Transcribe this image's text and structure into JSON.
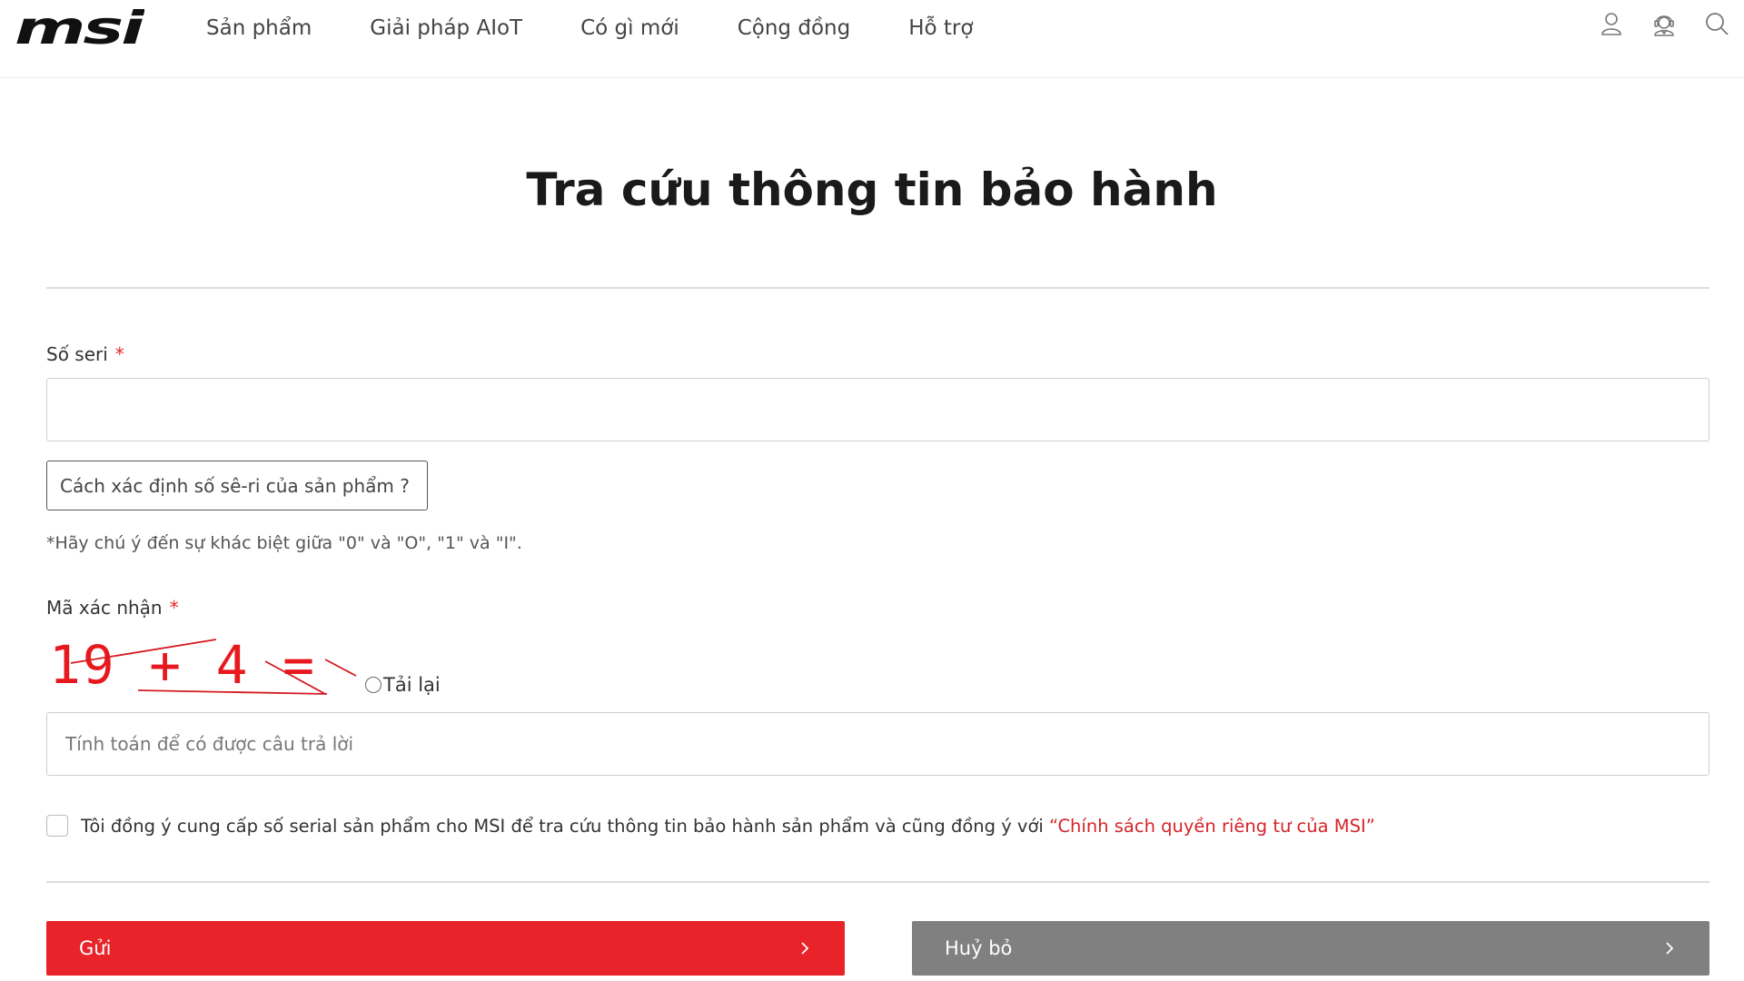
{
  "header": {
    "logo_text": "msi",
    "nav": [
      "Sản phẩm",
      "Giải pháp AIoT",
      "Có gì mới",
      "Cộng đồng",
      "Hỗ trợ"
    ],
    "icons": [
      "user-icon",
      "support-agent-icon",
      "search-icon"
    ]
  },
  "page": {
    "title": "Tra cứu thông tin bảo hành"
  },
  "form": {
    "serial": {
      "label": "Số seri",
      "required_mark": "*",
      "value": ""
    },
    "serial_help_button": "Cách xác định số sê-ri của sản phẩm ?",
    "note": "*Hãy chú ý đến sự khác biệt giữa \"0\" và \"O\", \"1\" và \"I\".",
    "captcha": {
      "label": "Mã xác nhận",
      "required_mark": "*",
      "expression": "19 + 4 =",
      "reload_label": "Tải lại",
      "placeholder": "Tính toán để có được câu trả lời",
      "value": ""
    },
    "consent": {
      "checked": false,
      "text": "Tôi đồng ý cung cấp số serial sản phẩm cho MSI để tra cứu thông tin bảo hành sản phẩm và cũng đồng ý với ",
      "link_text": "“Chính sách quyền riêng tư của MSI”"
    },
    "submit_label": "Gửi",
    "cancel_label": "Huỷ bỏ"
  },
  "colors": {
    "accent": "#e8232a",
    "cancel_gray": "#808080",
    "link_red": "#d6242a"
  }
}
